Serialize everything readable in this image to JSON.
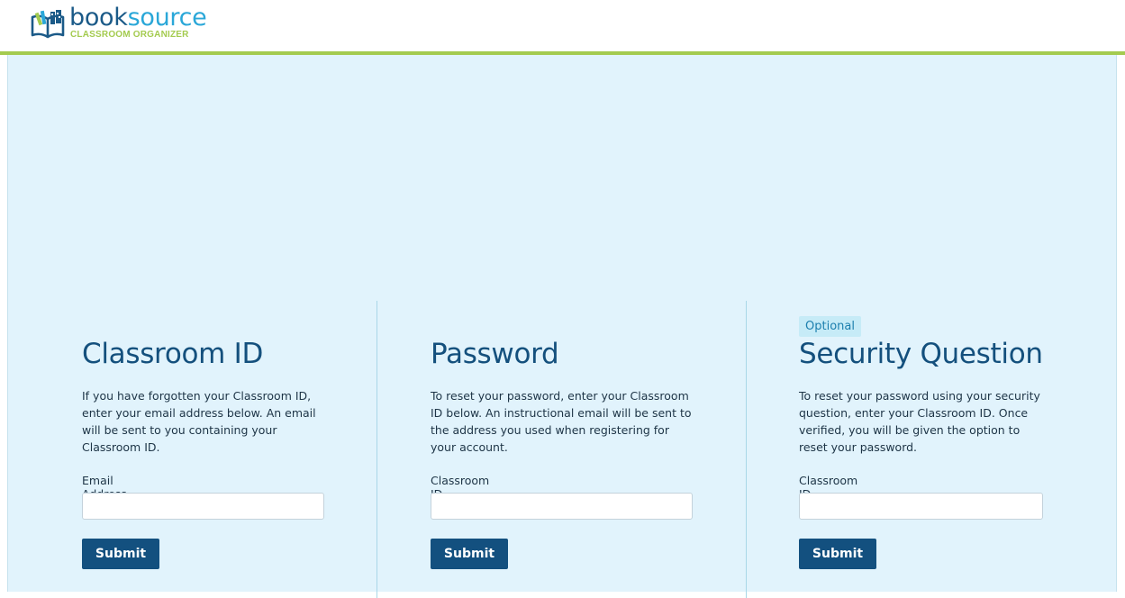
{
  "brand": {
    "name_part1": "book",
    "name_part2": "source",
    "tagline": "CLASSROOM ORGANIZER",
    "logo_icon": "open-book-icon",
    "colors": {
      "primary": "#14507d",
      "accent": "#2aa7d8",
      "green": "#a4cb4f",
      "panel_bg": "#e1f3fc"
    }
  },
  "columns": [
    {
      "title": "Classroom ID",
      "description": "If you have forgotten your Classroom ID, enter your email address below. An email will be sent to you containing your Classroom ID.",
      "field_label": "Email Address",
      "field_value": "",
      "button_label": "Submit"
    },
    {
      "title": "Password",
      "description": "To reset your password, enter your Classroom ID below. An instructional email will be sent to the address you used when registering for your account.",
      "field_label": "Classroom ID",
      "field_value": "",
      "button_label": "Submit"
    },
    {
      "badge": "Optional",
      "title": "Security Question",
      "description": "To reset your password using your security question, enter your Classroom ID. Once verified, you will be given the option to reset your password.",
      "field_label": "Classroom ID",
      "field_value": "",
      "button_label": "Submit"
    }
  ]
}
